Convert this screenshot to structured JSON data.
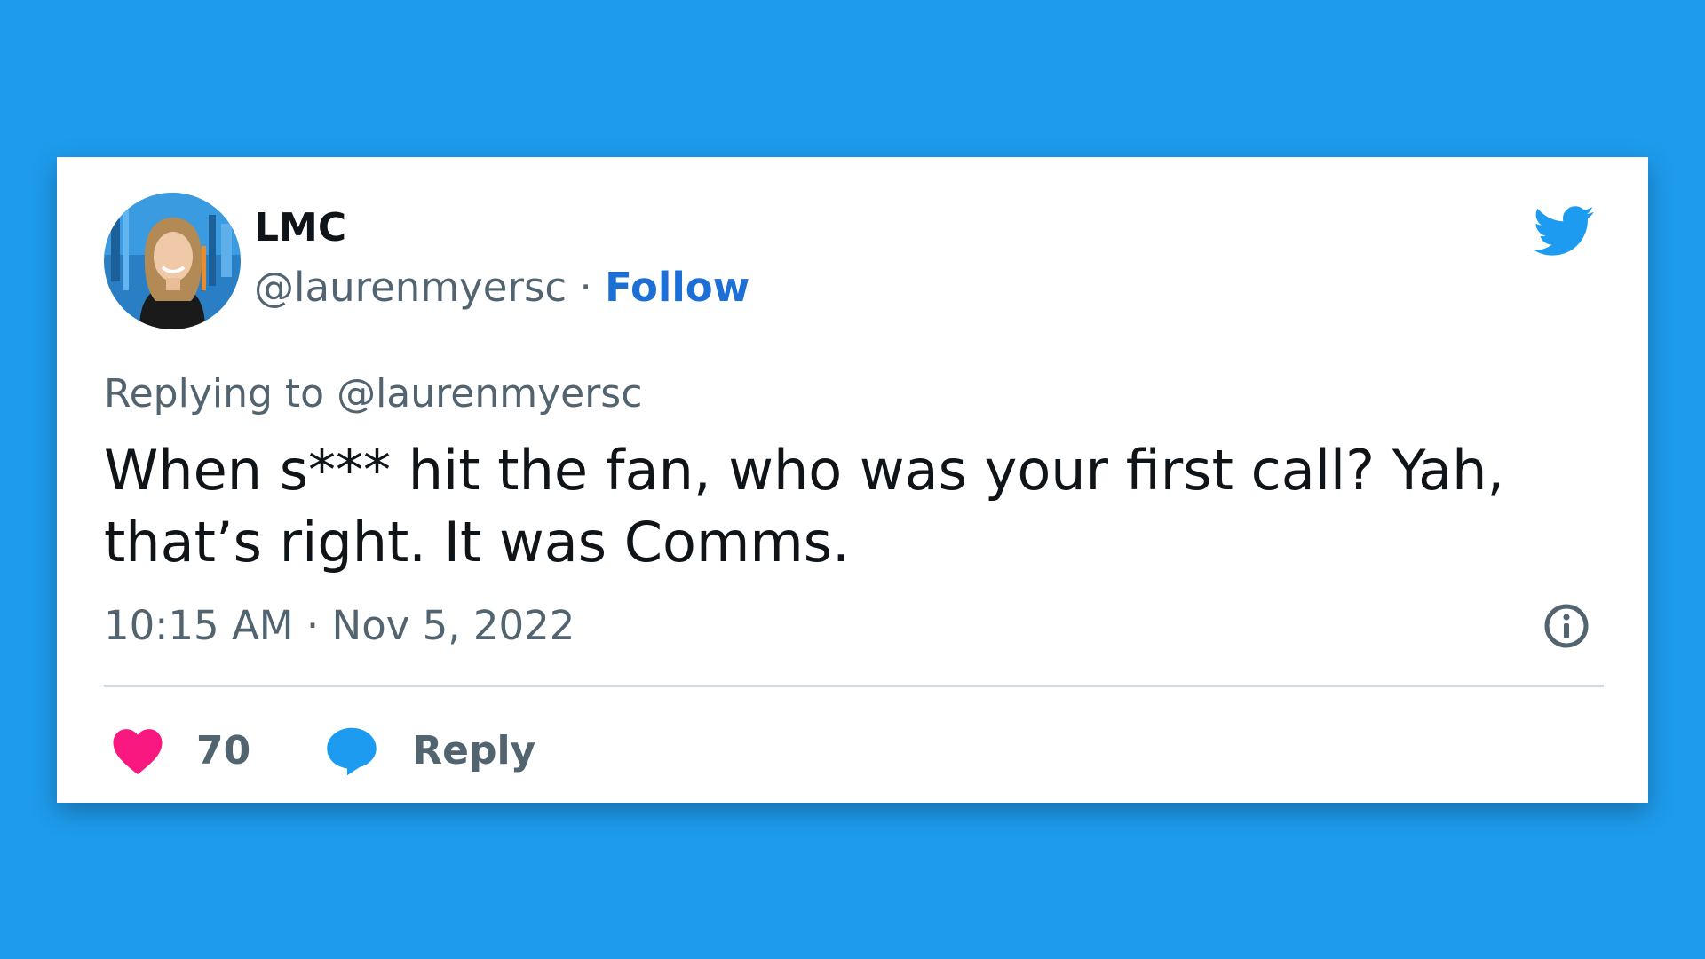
{
  "tweet": {
    "display_name": "LMC",
    "handle": "@laurenmyersc",
    "separator": "·",
    "follow_label": "Follow",
    "replying_prefix": "Replying to",
    "replying_to": "@laurenmyersc",
    "text": "When s*** hit the fan, who was your first call? Yah, that’s right. It was Comms.",
    "time": "10:15 AM",
    "date": "Nov 5, 2022",
    "like_count": "70",
    "reply_label": "Reply"
  },
  "icons": {
    "brand": "twitter-bird-icon",
    "info": "info-icon",
    "like": "heart-icon",
    "reply": "speech-bubble-icon"
  },
  "colors": {
    "background": "#1e9bec",
    "card": "#ffffff",
    "brand_blue": "#1d9bf0",
    "follow_link": "#1d6fd6",
    "heart": "#f91880",
    "muted_text": "#536471",
    "primary_text": "#0f1419"
  }
}
